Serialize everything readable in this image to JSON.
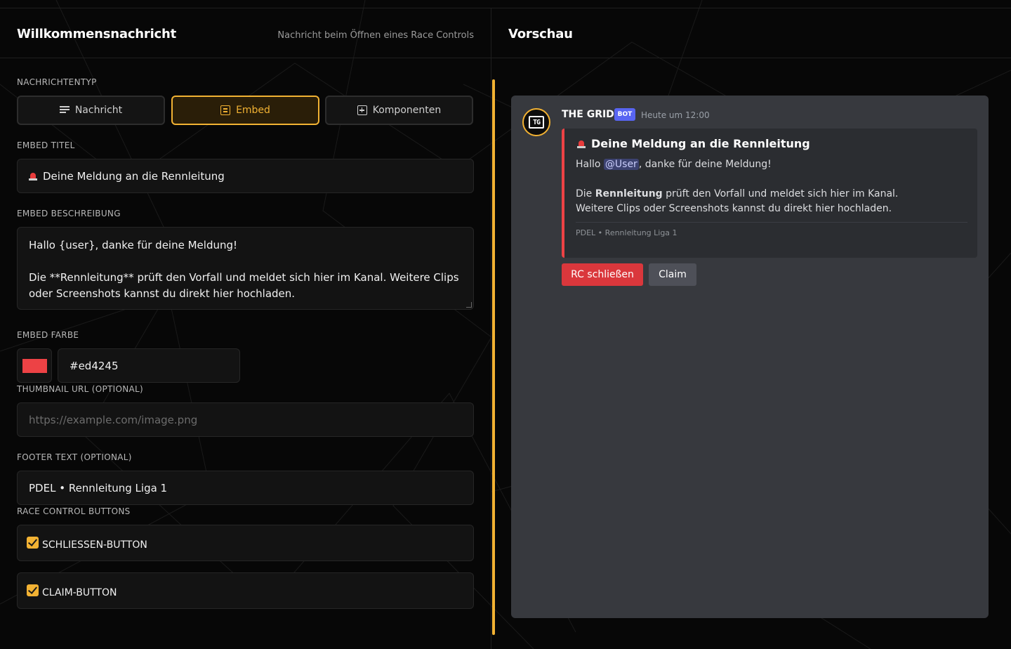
{
  "editor": {
    "title": "Willkommensnachricht",
    "subtitle": "Nachricht beim Öffnen eines Race Controls",
    "type_label": "NACHRICHTENTYP",
    "types": [
      {
        "label": "Nachricht",
        "icon": "lines-icon",
        "active": false
      },
      {
        "label": "Embed",
        "icon": "embed-icon",
        "active": true
      },
      {
        "label": "Komponenten",
        "icon": "plus-box-icon",
        "active": false
      }
    ],
    "embed_title_label": "EMBED TITEL",
    "embed_title_value": "Deine Meldung an die Rennleitung",
    "embed_desc_label": "EMBED BESCHREIBUNG",
    "embed_desc_line1": "Hallo {user}, danke für deine Meldung!",
    "embed_desc_line2": "Die **Rennleitung** prüft den Vorfall und meldet sich hier im Kanal. Weitere Clips oder Screenshots kannst du direkt hier hochladen.",
    "color_label": "EMBED FARBE",
    "color_value": "#ed4245",
    "thumbnail_label": "THUMBNAIL URL (OPTIONAL)",
    "thumbnail_placeholder": "https://example.com/image.png",
    "footer_label": "FOOTER TEXT (OPTIONAL)",
    "footer_value": "PDEL • Rennleitung Liga 1",
    "buttons_label": "RACE CONTROL BUTTONS",
    "checkbox_close": "SCHLIESSEN-BUTTON",
    "checkbox_claim": "CLAIM-BUTTON"
  },
  "preview": {
    "title": "Vorschau",
    "bot_name": "THE GRID",
    "bot_tag": "BOT",
    "avatar_text": "TG",
    "timestamp": "Heute um 12:00",
    "embed_title": "Deine Meldung an die Rennleitung",
    "desc_hallo": "Hallo ",
    "desc_mention": "@User",
    "desc_thanks": ", danke für deine Meldung!",
    "desc_die": "Die ",
    "desc_bold": "Rennleitung",
    "desc_rest": " prüft den Vorfall und meldet sich hier im Kanal.",
    "desc_line3": "Weitere Clips oder Screenshots kannst du direkt hier hochladen.",
    "footer": "PDEL • Rennleitung Liga 1",
    "btn_close": "RC schließen",
    "btn_claim": "Claim"
  },
  "colors": {
    "accent": "#f2b233",
    "embed": "#ed4245",
    "bot_tag": "#5865f2"
  }
}
